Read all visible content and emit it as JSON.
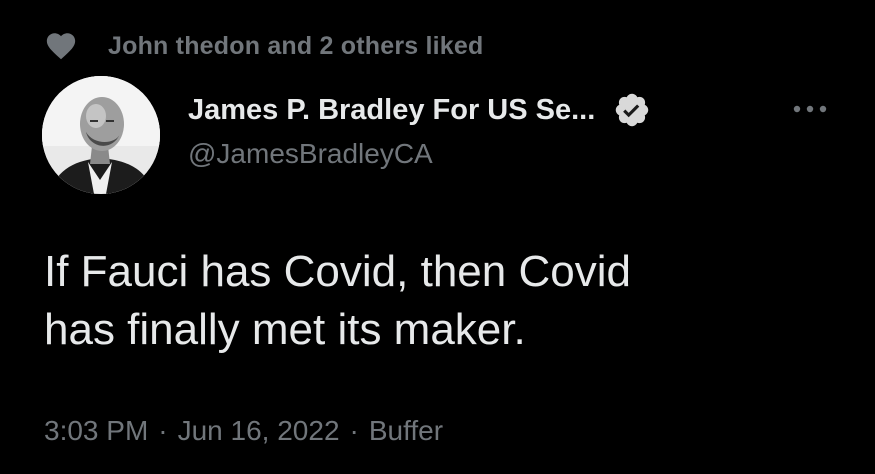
{
  "social_context": {
    "icon": "heart-icon",
    "text": "John thedon and 2 others liked"
  },
  "author": {
    "display_name": "James P. Bradley For US Se...",
    "handle": "@JamesBradleyCA",
    "verified_icon": "verified-badge-icon",
    "avatar_icon": "avatar"
  },
  "more_icon": "more-options-icon",
  "tweet": {
    "lines": [
      "If Fauci has Covid, then Covid",
      "has finally met its maker."
    ]
  },
  "meta": {
    "time": "3:03 PM",
    "separator": "·",
    "date": "Jun 16, 2022",
    "source": "Buffer"
  },
  "colors": {
    "background": "#000000",
    "primary_text": "#e7e9ea",
    "secondary_text": "#71767b",
    "verified_badge": "#d9d9d9"
  }
}
